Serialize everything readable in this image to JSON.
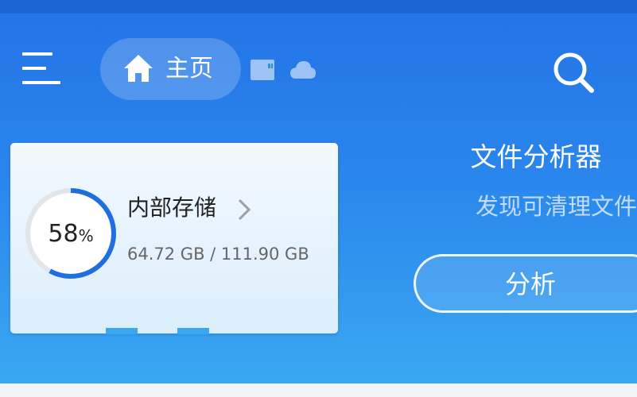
{
  "toolbar": {
    "menu_icon": "hamburger-menu-icon",
    "home_label": "主页",
    "home_icon": "home-icon",
    "sd_card_icon": "sd-card-icon",
    "cloud_icon": "cloud-icon",
    "search_icon": "search-icon"
  },
  "storage": {
    "percent": "58",
    "percent_symbol": "%",
    "used_fraction": 0.58,
    "title": "内部存储",
    "size": "64.72 GB / 111.90 GB"
  },
  "analyzer": {
    "title": "文件分析器",
    "subtitle": "发现可清理文件",
    "button_label": "分析"
  },
  "colors": {
    "header_top": "#1a66d6",
    "gradient_start": "#2474e6",
    "gradient_end": "#3aa8f2",
    "ring_accent": "#1f6fe0",
    "card_bg": "#e8f3fd"
  }
}
